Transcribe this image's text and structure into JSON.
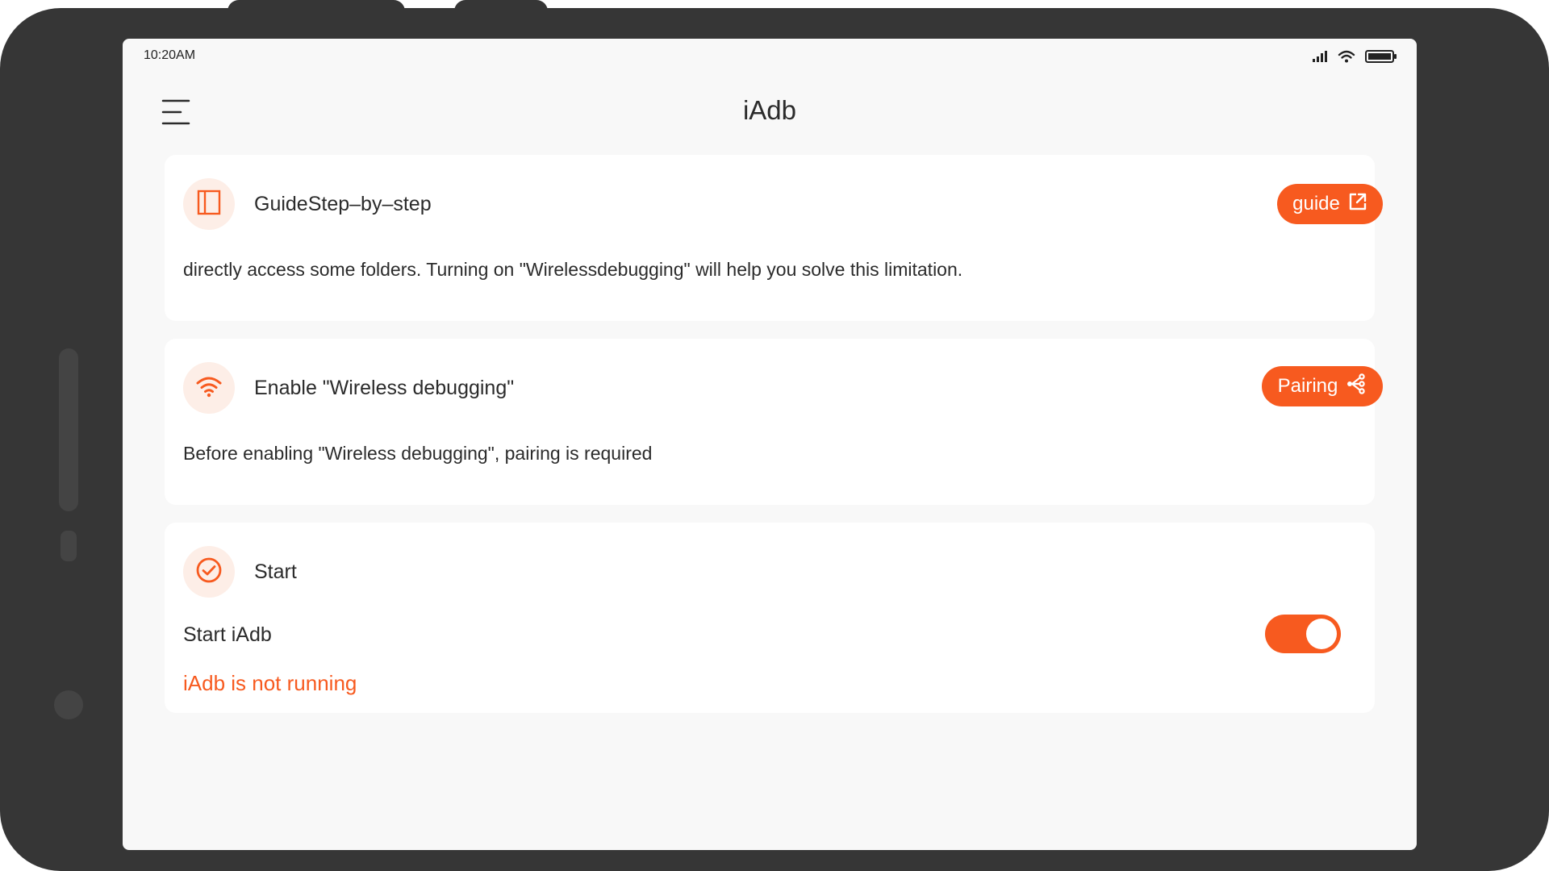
{
  "status_bar": {
    "time": "10:20AM",
    "icons": [
      "signal-icon",
      "wifi-icon",
      "battery-icon"
    ]
  },
  "app_bar": {
    "title": "iAdb",
    "menu_icon": "hamburger-menu-icon"
  },
  "cards": {
    "guide": {
      "icon": "book-icon",
      "title": "GuideStep–by–step",
      "button_label": "guide",
      "button_icon": "external-link-icon",
      "description": "directly access some folders. Turning on \"Wirelessdebugging\" will help you solve this limitation."
    },
    "wireless": {
      "icon": "wifi-icon",
      "title": "Enable \"Wireless debugging\"",
      "button_label": "Pairing",
      "button_icon": "share-icon",
      "description": "Before enabling \"Wireless debugging\", pairing is required"
    },
    "start": {
      "icon": "check-circle-icon",
      "title": "Start",
      "toggle_label": "Start iAdb",
      "toggle_on": true,
      "status": "iAdb is not running"
    }
  },
  "colors": {
    "accent": "#f75a1f",
    "icon_bg": "#fdeee7",
    "screen_bg": "#f8f8f8",
    "device_frame": "#363636"
  }
}
